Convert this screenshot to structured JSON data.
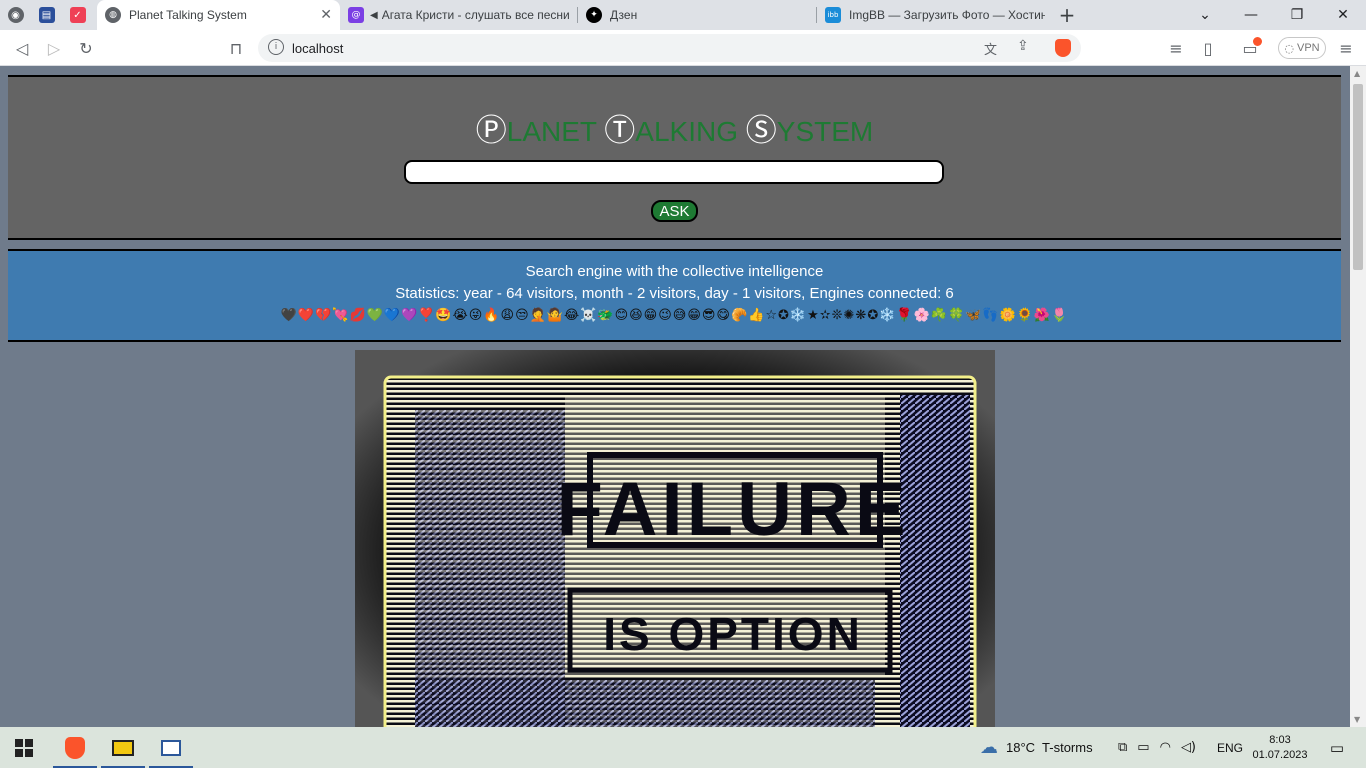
{
  "browser": {
    "tabs": [
      {
        "title": "Planet Talking System",
        "active": true
      },
      {
        "title": "Агата Кристи - слушать все песни",
        "active": false
      },
      {
        "title": "Дзен",
        "active": false
      },
      {
        "title": "ImgBB — Загрузить Фото — Хостинг",
        "active": false
      }
    ],
    "pinned_icons": [
      "radio-icon",
      "calendar-icon",
      "pocket-icon"
    ],
    "new_tab": "+",
    "window_controls": {
      "minimize": "—",
      "maximize": "❐",
      "close": "✕",
      "tab_search": "⌄"
    },
    "url": "localhost",
    "vpn_label": "VPN",
    "colors": {
      "tab_strip": "#dee1e6",
      "brave": "#fb542b"
    }
  },
  "page": {
    "logo": {
      "parts": [
        {
          "initial": "Ⓟ",
          "rest": "LANET "
        },
        {
          "initial": "Ⓣ",
          "rest": "ALKING "
        },
        {
          "initial": "Ⓢ",
          "rest": "YSTEM"
        }
      ]
    },
    "search": {
      "value": "",
      "placeholder": ""
    },
    "ask_label": "ASK",
    "stats": {
      "tagline": "Search engine with the collective intelligence",
      "line": "Statistics: year - 64 visitors, month - 2 visitors, day - 1 visitors, Engines connected: 6",
      "emoji_row": "🖤❤️💔💘💋💚💙💜❣️🤩😭😜🔥😩😒🤦🤷😂☠️🐲😊😆😁😉😅😁😎😋🥐👍☆✪❄️★✫❊✺❋✪❄️🌹🌸☘️🍀🦋👣🌼🌻🌺🌷"
    },
    "image_caption": [
      "FAILURE",
      "IS OPTION"
    ],
    "colors": {
      "page_bg": "#6f7b8b",
      "header_bg": "#646464",
      "logo_green": "#1e7a33",
      "stats_bg": "#3f7bb0"
    }
  },
  "taskbar": {
    "apps": [
      "start-icon",
      "brave-icon",
      "winamp-icon",
      "app-icon"
    ],
    "weather": "18°C  T-storms",
    "language": "ENG",
    "time": "8:03",
    "date": "01.07.2023"
  }
}
